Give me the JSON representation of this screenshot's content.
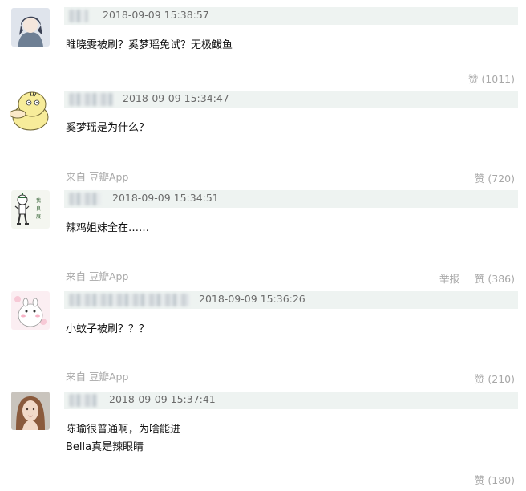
{
  "comments": [
    {
      "timestamp": "2018-09-09 15:38:57",
      "content": [
        "睢晓雯被刷？奚梦瑶免试？无极鲅鱼"
      ],
      "source": "",
      "report": "",
      "like_label": "赞 (1011)",
      "avatar_icon": "anime-portrait-avatar"
    },
    {
      "timestamp": "2018-09-09 15:34:47",
      "content": [
        "奚梦瑶是为什么？"
      ],
      "source": "来自 豆瓣App",
      "report": "",
      "like_label": "赞 (720)",
      "avatar_icon": "psyduck-avatar"
    },
    {
      "timestamp": "2018-09-09 15:34:51",
      "content": [
        "辣鸡姐妹全在……"
      ],
      "source": "来自 豆瓣App",
      "report": "举报",
      "like_label": "赞 (386)",
      "avatar_icon": "cartoon-character-avatar",
      "avatar_text": "我良展"
    },
    {
      "timestamp": "2018-09-09 15:36:26",
      "content": [
        "小蚊子被刷？？？"
      ],
      "source": "来自 豆瓣App",
      "report": "",
      "like_label": "赞 (210)",
      "avatar_icon": "moomin-avatar"
    },
    {
      "timestamp": "2018-09-09 15:37:41",
      "content": [
        "陈瑜很普通啊，为啥能进",
        "Bella真是辣眼睛"
      ],
      "source": "",
      "report": "",
      "like_label": "赞 (180)",
      "avatar_icon": "woman-portrait-avatar"
    }
  ],
  "colors": {
    "header_bar": "#eef3f1",
    "meta_text": "#a8a8a8",
    "timestamp_text": "#6b6b6b"
  }
}
